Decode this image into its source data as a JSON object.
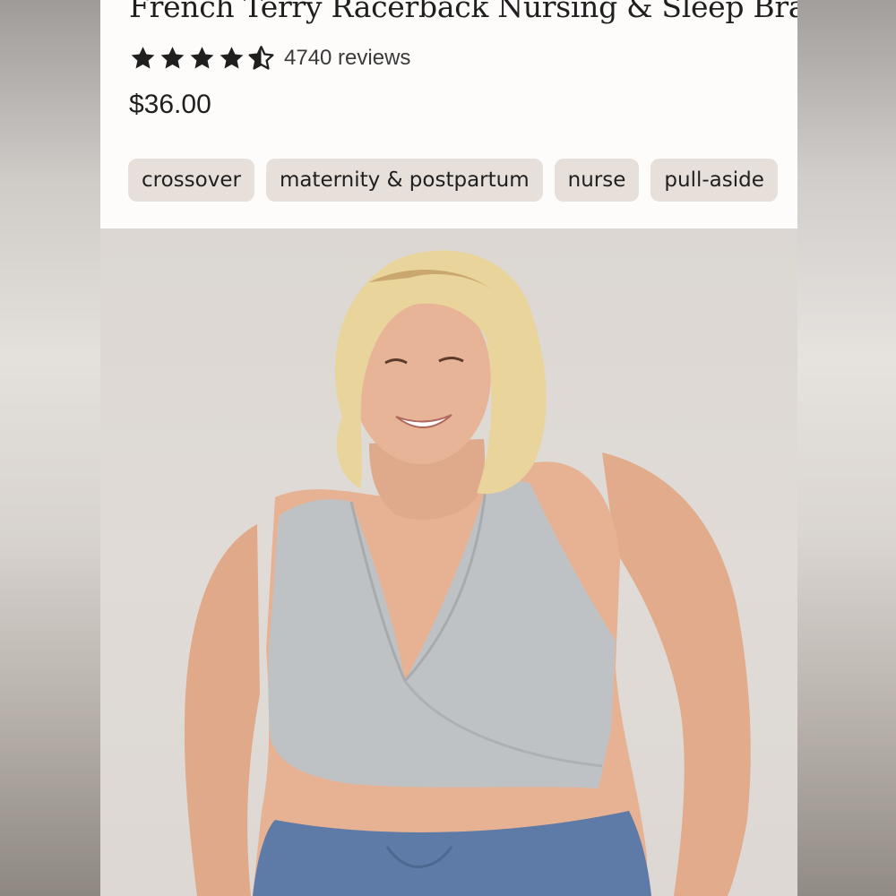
{
  "product": {
    "title": "French Terry Racerback Nursing & Sleep Bra",
    "rating": 4.5,
    "reviews_text": "4740 reviews",
    "price": "$36.00"
  },
  "tags": [
    "crossover",
    "maternity & postpartum",
    "nurse",
    "pull-aside"
  ],
  "photo": {
    "subject": "model-wearing-grey-wrap-nursing-bra"
  },
  "colors": {
    "tag_background": "#e6dfda",
    "bra_grey": "#bfc2c5",
    "pants_blue": "#5e7aa6"
  }
}
